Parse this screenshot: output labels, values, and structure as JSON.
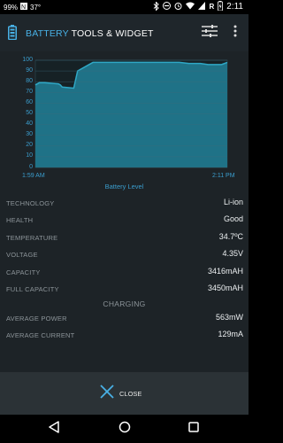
{
  "status_bar": {
    "battery_pct": "99%",
    "temperature": "37°",
    "signal_letter": "R",
    "time": "2:11"
  },
  "toolbar": {
    "title_part1": "BATTERY",
    "title_part2": "TOOLS & WIDGET"
  },
  "chart_data": {
    "type": "line",
    "title": "Battery Level",
    "x_range_labels": [
      "1:59 AM",
      "2:11 PM"
    ],
    "ylim": [
      0,
      100
    ],
    "y_ticks": [
      0,
      10,
      20,
      30,
      40,
      50,
      60,
      70,
      80,
      90,
      100
    ],
    "grid": true,
    "series": [
      {
        "x": [
          0,
          0.02,
          0.05,
          0.12,
          0.13,
          0.14,
          0.2,
          0.22,
          0.3,
          0.5,
          0.75,
          0.8,
          0.86,
          0.9,
          0.94,
          0.97,
          1.0
        ],
        "values": [
          77,
          79,
          79,
          78,
          77,
          75,
          74,
          90,
          98,
          98,
          98,
          97,
          97,
          96,
          96,
          96,
          98
        ]
      }
    ]
  },
  "properties": [
    {
      "label": "TECHNOLOGY",
      "value": "Li-ion"
    },
    {
      "label": "HEALTH",
      "value": "Good"
    },
    {
      "label": "TEMPERATURE",
      "value": "34.7ºC"
    },
    {
      "label": "VOLTAGE",
      "value": "4.35V"
    },
    {
      "label": "CAPACITY",
      "value": "3416mAH"
    },
    {
      "label": "FULL CAPACITY",
      "value": "3450mAH"
    }
  ],
  "section": {
    "charging_header": "CHARGING"
  },
  "charging": [
    {
      "label": "AVERAGE POWER",
      "value": "563mW"
    },
    {
      "label": "AVERAGE CURRENT",
      "value": "129mA"
    }
  ],
  "footer": {
    "close_label": "CLOSE"
  },
  "colors": {
    "accent": "#48b1e6",
    "chart_fill": "#1f7287",
    "chart_line": "#2fa8c6",
    "background": "#1d2327"
  }
}
